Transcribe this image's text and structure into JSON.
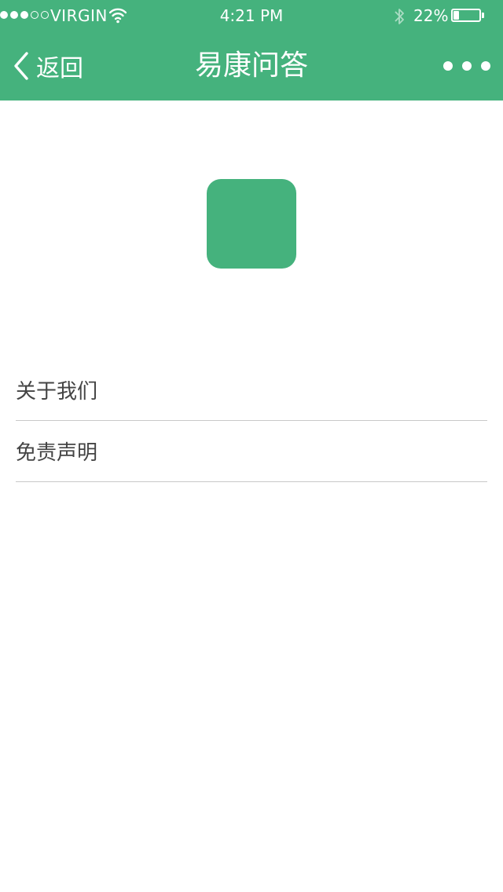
{
  "status_bar": {
    "carrier": "VIRGIN",
    "time": "4:21 PM",
    "battery_percent": "22%",
    "battery_level": 0.22,
    "signal_strength": 3,
    "signal_max": 5
  },
  "nav": {
    "back_label": "返回",
    "title": "易康问答"
  },
  "logo": {
    "color": "#45b27d"
  },
  "menu": {
    "items": [
      {
        "label": "关于我们"
      },
      {
        "label": "免责声明"
      }
    ]
  },
  "theme": {
    "accent": "#45b27d",
    "text": "#444444",
    "divider": "#c8c8c8"
  }
}
